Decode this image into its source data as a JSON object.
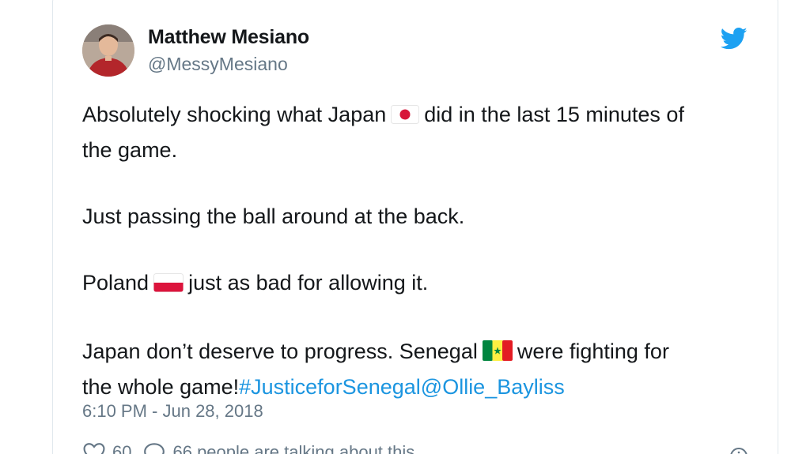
{
  "author": {
    "display_name": "Matthew Mesiano",
    "handle": "@MessyMesiano"
  },
  "icons": {
    "brand": "twitter-bird-icon",
    "like": "heart-icon",
    "reply": "speech-bubble-icon",
    "info": "info-icon"
  },
  "colors": {
    "link": "#1b95e0",
    "secondary_text": "#657786",
    "brand": "#1da1f2"
  },
  "tweet": {
    "line1_before": "Absolutely shocking what Japan",
    "line1_after": "did in the last 15 minutes of",
    "line2": "the game.",
    "line3": "Just passing the ball around at the back.",
    "line4_before": "Poland",
    "line4_after": "just as bad for allowing it.",
    "line5_before": "Japan don’t deserve to progress. Senegal",
    "line5_after": "were fighting for",
    "line6_text": "the whole game!",
    "hashtag": "#JusticeforSenegal",
    "mention": "@Ollie_Bayliss",
    "flags": [
      "japan-flag",
      "poland-flag",
      "senegal-flag"
    ]
  },
  "timestamp": "6:10 PM - Jun 28, 2018",
  "actions": {
    "like_count": "60",
    "talking_text": "66 people are talking about this"
  }
}
